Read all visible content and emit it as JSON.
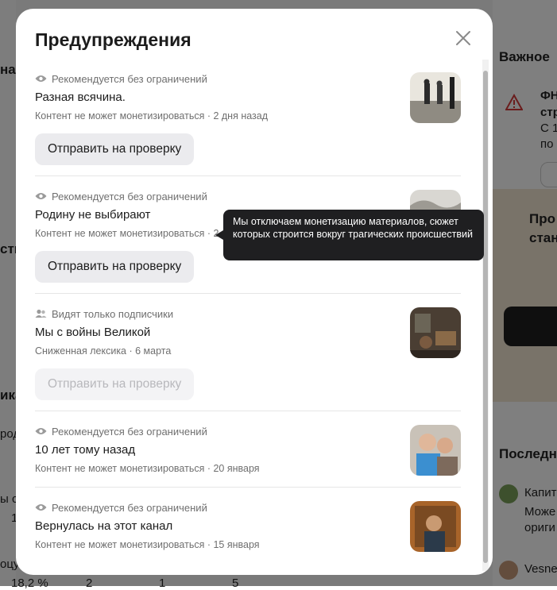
{
  "background": {
    "right_heading_1": "Важное",
    "right_heading_2": "Последн",
    "right_snippets": [
      "ФН",
      "стр",
      "С 1",
      "по",
      "Про",
      "стан",
      "Капит",
      "Може",
      "ориги",
      "Vesnel"
    ],
    "left_snippets": [
      "на",
      "сти",
      "ика",
      "род",
      "ы с",
      "1",
      "оцу",
      "18,2 %",
      "2",
      "1",
      "5"
    ]
  },
  "modal": {
    "title": "Предупреждения",
    "close_icon": "close-icon",
    "items": [
      {
        "visibility_icon": "eye-icon",
        "visibility": "Рекомендуется без ограничений",
        "title": "Разная всячина.",
        "subtitle": "Контент не может монетизироваться · 2 дня назад",
        "button": "Отправить на проверку",
        "button_disabled": false,
        "thumbnail": "thumbnail-vintage-couple"
      },
      {
        "visibility_icon": "eye-icon",
        "visibility": "Рекомендуется без ограничений",
        "title": "Родину не выбирают",
        "subtitle": "Контент не может монетизироваться · 2",
        "button": "Отправить на проверку",
        "button_disabled": false,
        "thumbnail": "thumbnail-engraving"
      },
      {
        "visibility_icon": "people-icon",
        "visibility": "Видят только подписчики",
        "title": "Мы с войны Великой",
        "subtitle": "Сниженная лексика · 6 марта",
        "button": "Отправить на проверку",
        "button_disabled": true,
        "thumbnail": "thumbnail-painting-room"
      },
      {
        "visibility_icon": "eye-icon",
        "visibility": "Рекомендуется без ограничений",
        "title": "10 лет тому назад",
        "subtitle": "Контент не может монетизироваться · 20 января",
        "thumbnail": "thumbnail-children"
      },
      {
        "visibility_icon": "eye-icon",
        "visibility": "Рекомендуется без ограничений",
        "title": "Вернулась на этот канал",
        "subtitle": "Контент не может монетизироваться · 15 января",
        "thumbnail": "thumbnail-painting-portrait"
      }
    ],
    "tooltip": "Мы отключаем монетизацию материалов, сюжет которых строится вокруг трагических происшествий"
  },
  "colors": {
    "overlay": "#00000080",
    "button_bg": "#ebebee",
    "tooltip_bg": "#1f1f21",
    "muted_text": "#6f6f6f"
  }
}
